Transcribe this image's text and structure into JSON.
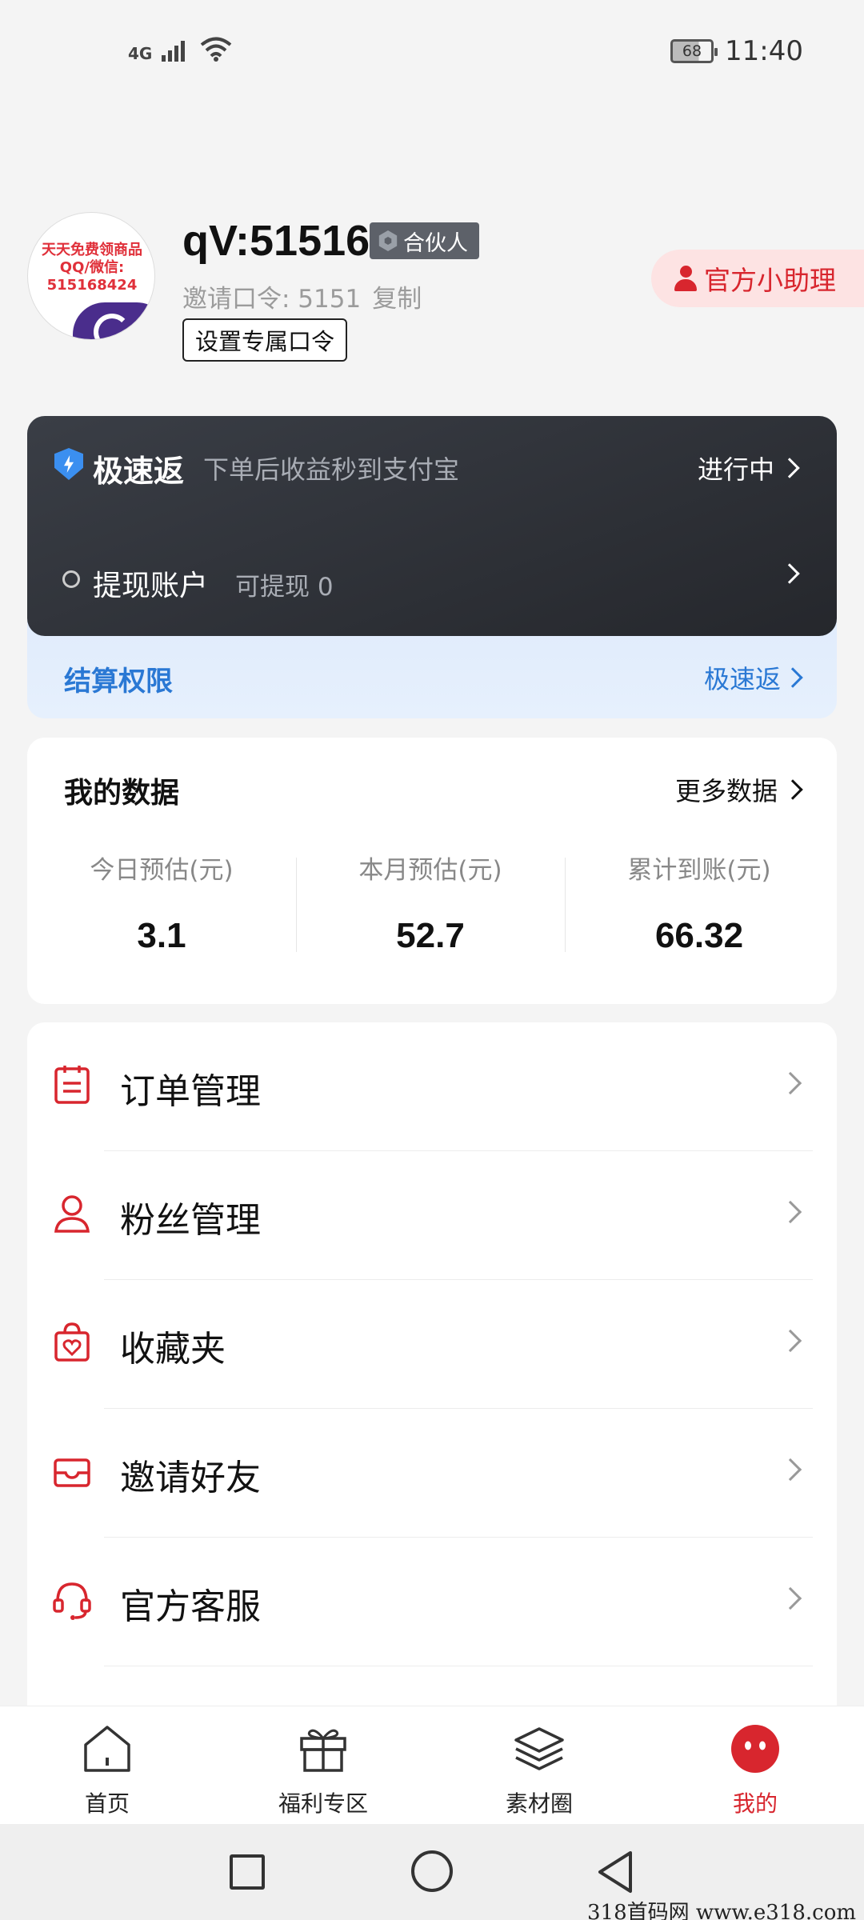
{
  "status_bar": {
    "network": "4G",
    "battery": "68",
    "time": "11:40"
  },
  "profile": {
    "avatar_watermark": "天天免费领商品QQ/微信: 515168424",
    "name": "qV:51516",
    "badge": "合伙人",
    "invite_code_label": "邀请口令: 5151",
    "copy_label": "复制",
    "set_code_button": "设置专属口令",
    "helper_button": "官方小助理"
  },
  "fast_rebate": {
    "title": "极速返",
    "description": "下单后收益秒到支付宝",
    "status": "进行中",
    "withdraw_title": "提现账户",
    "withdraw_amount": "可提现 0"
  },
  "settlement": {
    "label": "结算权限",
    "link": "极速返"
  },
  "my_data": {
    "title": "我的数据",
    "more": "更多数据",
    "stats": [
      {
        "label": "今日预估(元)",
        "value": "3.1"
      },
      {
        "label": "本月预估(元)",
        "value": "52.7"
      },
      {
        "label": "累计到账(元)",
        "value": "66.32"
      }
    ]
  },
  "menu": [
    {
      "label": "订单管理",
      "icon": "order-icon"
    },
    {
      "label": "粉丝管理",
      "icon": "fans-icon"
    },
    {
      "label": "收藏夹",
      "icon": "favorites-icon"
    },
    {
      "label": "邀请好友",
      "icon": "invite-icon"
    },
    {
      "label": "官方客服",
      "icon": "headset-icon"
    }
  ],
  "bottom_nav": [
    {
      "label": "首页",
      "icon": "home-icon"
    },
    {
      "label": "福利专区",
      "icon": "gift-icon"
    },
    {
      "label": "素材圈",
      "icon": "layers-icon"
    },
    {
      "label": "我的",
      "icon": "profile-face-icon"
    }
  ],
  "watermark": "318首码网  www.e318.com",
  "colors": {
    "accent": "#d8262e",
    "link_blue": "#2a78d4",
    "card_dark": "#2b2e34"
  }
}
